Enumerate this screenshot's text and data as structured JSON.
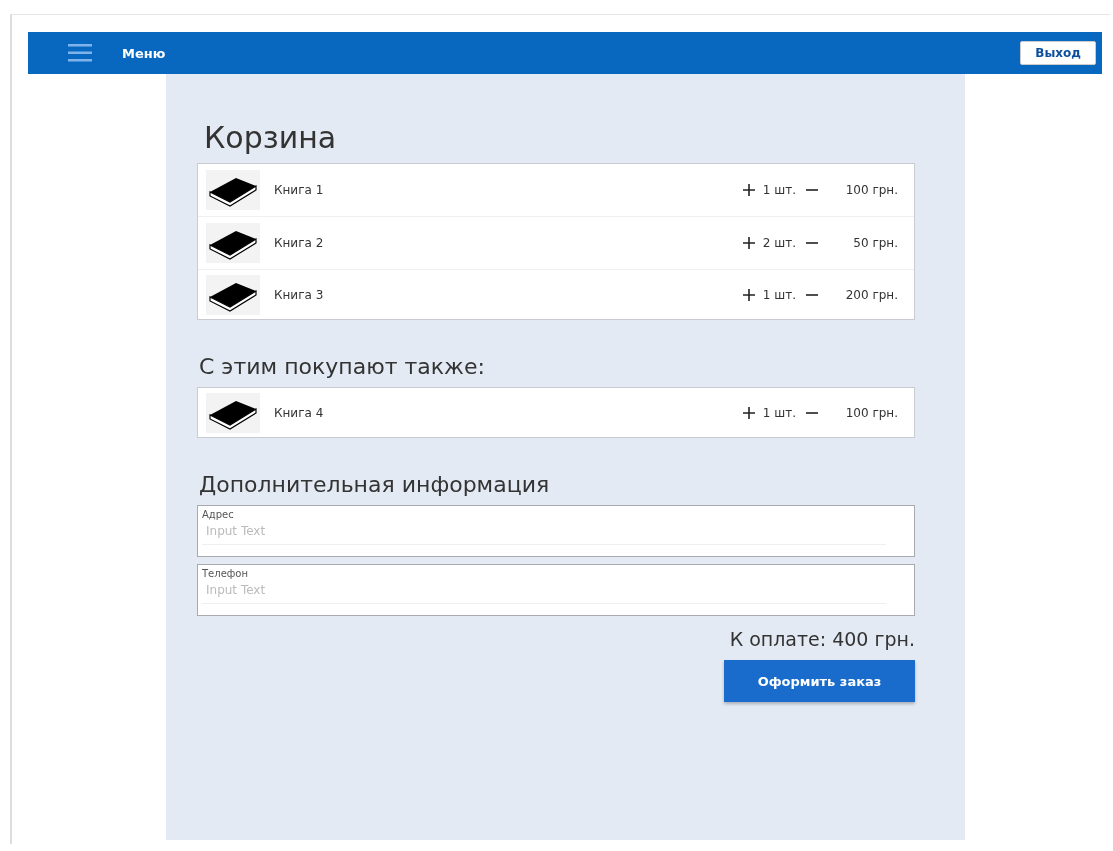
{
  "top_bar": {
    "menu_label": "Меню",
    "logout_button": "Выход"
  },
  "cart": {
    "title": "Корзина",
    "items": [
      {
        "name": "Книга 1",
        "quantity": "1 шт.",
        "price": "100 грн."
      },
      {
        "name": "Книга 2",
        "quantity": "2 шт.",
        "price": "50 грн."
      },
      {
        "name": "Книга 3",
        "quantity": "1 шт.",
        "price": "200 грн."
      }
    ]
  },
  "also_bought": {
    "title": "С этим покупают также:",
    "items": [
      {
        "name": "Книга 4",
        "quantity": "1 шт.",
        "price": "100 грн."
      }
    ]
  },
  "additional_info": {
    "title": "Дополнительная информация",
    "fields": [
      {
        "label": "Адрес",
        "placeholder": "Input Text"
      },
      {
        "label": "Телефон",
        "placeholder": "Input Text"
      }
    ]
  },
  "total": "К оплате: 400 грн.",
  "submit_button": "Оформить заказ"
}
